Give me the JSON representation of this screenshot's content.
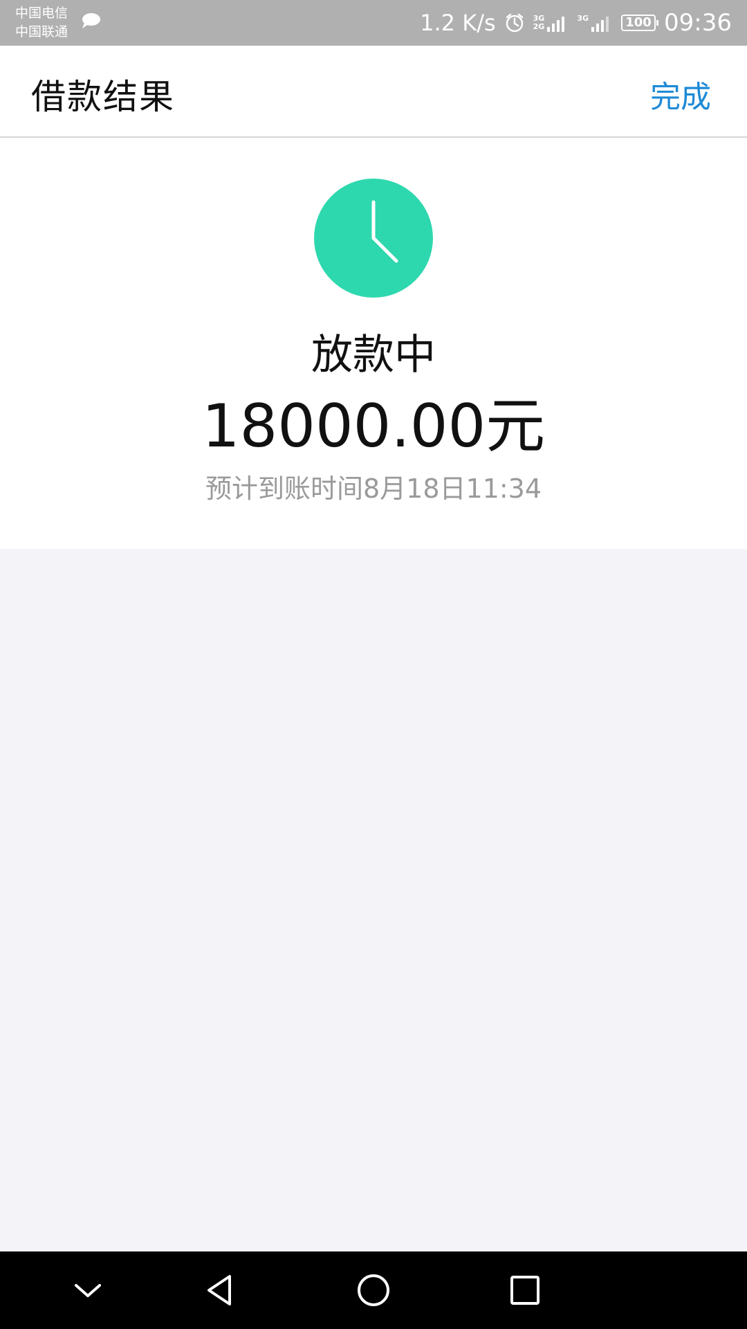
{
  "status_bar": {
    "carrier_1": "中国电信",
    "carrier_2": "中国联通",
    "network_speed": "1.2 K/s",
    "sim1_network_top": "3G",
    "sim1_network_bottom": "2G",
    "sim2_network": "3G",
    "battery_level": "100",
    "time": "09:36",
    "icons": [
      "chat-bubble-icon",
      "alarm-icon",
      "signal-icon",
      "signal-icon",
      "battery-icon"
    ]
  },
  "header": {
    "title": "借款结果",
    "done_label": "完成"
  },
  "result": {
    "status_icon": "clock-icon",
    "status": "放款中",
    "amount": "18000.00元",
    "eta": "预计到账时间8月18日11:34"
  },
  "nav_bar": {
    "icons": [
      "chevron-down-icon",
      "back-triangle-icon",
      "home-circle-icon",
      "recents-square-icon"
    ]
  },
  "colors": {
    "accent_blue": "#1e8ad6",
    "clock_green": "#2ed8ae",
    "status_bar_gray": "#b0b0b0",
    "page_background": "#f3f3f8",
    "secondary_text": "#9a9a9a"
  }
}
